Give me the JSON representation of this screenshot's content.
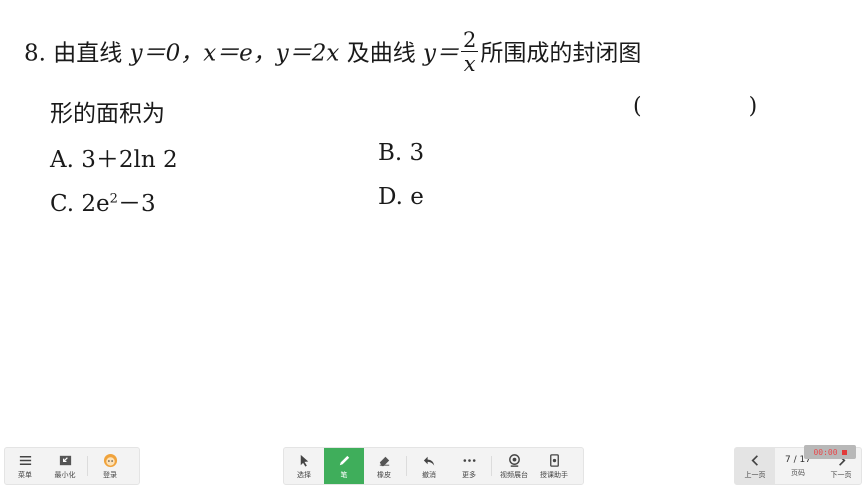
{
  "question": {
    "line1_prefix": "8. 由直线 ",
    "line1_eq": "y＝0，x＝e，y＝2x",
    "line1_mid": " 及曲线 ",
    "line1_y": "y＝",
    "frac_num": "2",
    "frac_den": "x",
    "line1_suffix": "所围成的封闭图",
    "line2": "形的面积为",
    "paren": "(  )",
    "options": {
      "A": "A. 3＋2ln 2",
      "B": "B. 3",
      "C_prefix": "C. 2e",
      "C_sup": "2",
      "C_suffix": "－3",
      "D": "D. e"
    }
  },
  "toolbar_left": {
    "menu": "菜单",
    "minimize": "最小化",
    "login": "登录"
  },
  "toolbar_mid": {
    "select": "选择",
    "pen": "笔",
    "eraser": "橡皮",
    "undo": "撤消",
    "more": "更多",
    "video_booth": "视频展台",
    "assistant": "授课助手"
  },
  "toolbar_right": {
    "prev": "上一页",
    "page_label": "页码",
    "page_value": "7 / 17",
    "next": "下一页"
  },
  "timer": "00:00",
  "colors": {
    "accent": "#3fae5b",
    "timer_red": "#e23b3b"
  }
}
